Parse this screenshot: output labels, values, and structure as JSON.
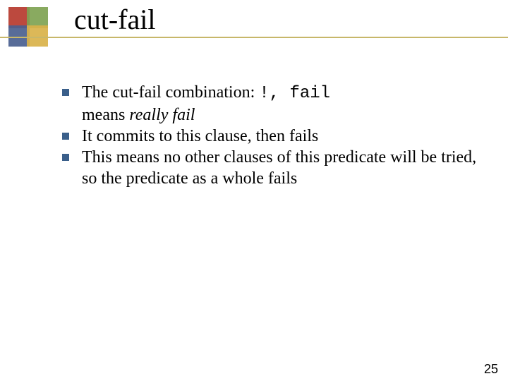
{
  "title": "cut-fail",
  "bullets": [
    {
      "pre": "The cut-fail combination:   ",
      "code": "!, fail",
      "post1": "means ",
      "emph": "really fail",
      "post2": ""
    },
    {
      "pre": "It commits to this clause, then fails",
      "code": "",
      "post1": "",
      "emph": "",
      "post2": ""
    },
    {
      "pre": "This means no other clauses of this predicate will be tried, so the predicate as a whole fails",
      "code": "",
      "post1": "",
      "emph": "",
      "post2": ""
    }
  ],
  "page_number": "25"
}
